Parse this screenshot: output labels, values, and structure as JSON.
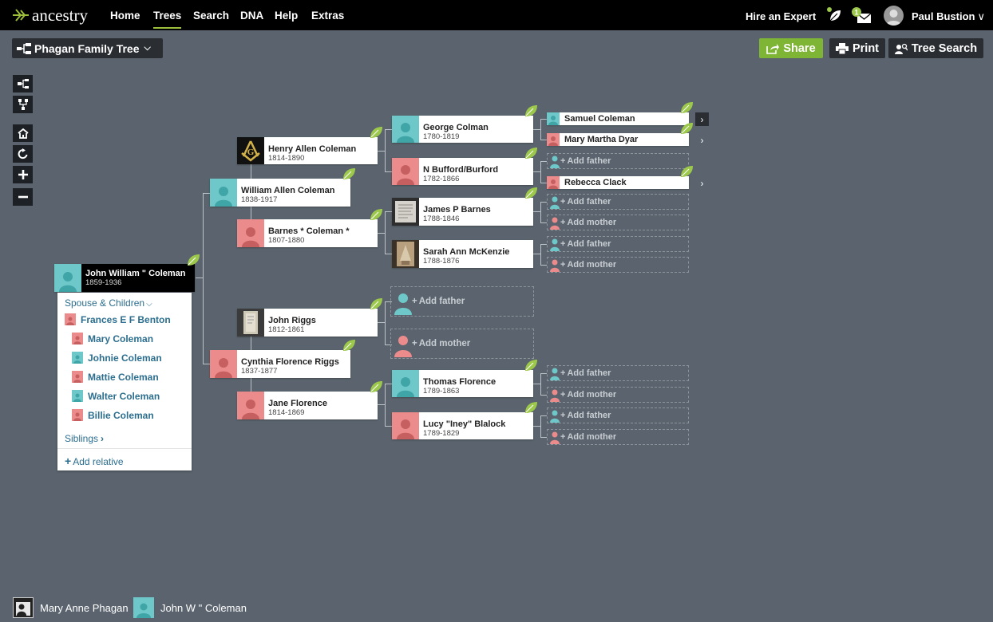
{
  "nav": {
    "logo_text": "ancestry",
    "links": [
      "Home",
      "Trees",
      "Search",
      "DNA",
      "Help",
      "Extras"
    ],
    "hire_expert": "Hire an Expert",
    "messages_count": "1",
    "user_name": "Paul Bustion"
  },
  "toolbar": {
    "tree_name": "Phagan Family Tree",
    "share": "Share",
    "print": "Print",
    "tree_search": "Tree Search"
  },
  "focus": {
    "name": "John William \" Coleman",
    "years": "1859-1936"
  },
  "panel": {
    "spouse_children": "Spouse & Children",
    "spouse": "Frances E F Benton",
    "children": [
      "Mary Coleman",
      "Johnie Coleman",
      "Mattie Coleman",
      "Walter Coleman",
      "Billie Coleman"
    ],
    "siblings": "Siblings",
    "add_relative": "Add relative"
  },
  "parents": {
    "father": {
      "name": "William Allen Coleman",
      "years": "1838-1917"
    },
    "mother": {
      "name": "Cynthia Florence Riggs",
      "years": "1837-1877"
    }
  },
  "grandparents": {
    "henry": {
      "name": "Henry Allen Coleman",
      "years": "1814-1890"
    },
    "barnes": {
      "name": "Barnes * Coleman *",
      "years": "1807-1880"
    },
    "riggs": {
      "name": "John Riggs",
      "years": "1812-1861"
    },
    "jane": {
      "name": "Jane Florence",
      "years": "1814-1869"
    }
  },
  "great_grandparents": {
    "george": {
      "name": "George Colman",
      "years": "1780-1819"
    },
    "bufford": {
      "name": "N Bufford/Burford",
      "years": "1782-1866"
    },
    "james": {
      "name": "James P Barnes",
      "years": "1788-1846"
    },
    "sarah": {
      "name": "Sarah Ann McKenzie",
      "years": "1788-1876"
    },
    "thomas": {
      "name": "Thomas Florence",
      "years": "1789-1863"
    },
    "lucy": {
      "name": "Lucy \"Iney\" Blalock",
      "years": "1789-1829"
    }
  },
  "gen5": {
    "samuel": "Samuel Coleman",
    "mary": "Mary Martha Dyar",
    "rebecca": "Rebecca Clack"
  },
  "add_father": "Add father",
  "add_mother": "Add mother",
  "footer": {
    "home_person": "Mary Anne Phagan",
    "current_person": "John W \" Coleman"
  },
  "colors": {
    "male": "#6ec8c9",
    "female": "#ec8b8b",
    "hint_leaf": "#9cc84b",
    "share_green": "#7fb535",
    "canvas": "#5b646e"
  }
}
